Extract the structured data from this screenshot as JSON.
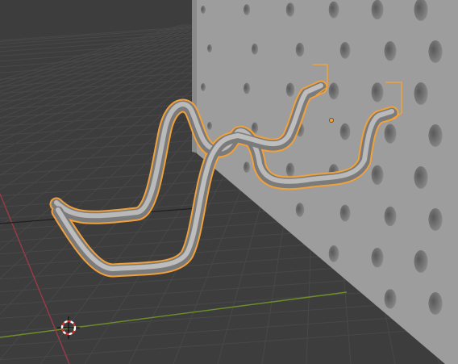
{
  "app": "Blender",
  "viewport": {
    "view": "3d-viewport",
    "shading": "solid",
    "colors": {
      "background": "#3d3d3d",
      "grid_line": "#474747",
      "x_axis": "#9a3b47",
      "y_axis": "#6e8f2a",
      "pegboard": "#9d9d9d",
      "pegboard_side": "#8c8c8c",
      "hole": "#6f6f6f",
      "hook": "#a4a4a4",
      "selection_outline": "#f2a13a"
    },
    "objects": [
      {
        "name": "pegboard",
        "icon": "pegboard-mesh",
        "selected": false
      },
      {
        "name": "hook",
        "icon": "curve-object",
        "selected": true
      }
    ],
    "gizmos": [
      {
        "name": "3d-cursor",
        "icon": "crosshair-cursor"
      },
      {
        "name": "object-origin",
        "icon": "origin-dot"
      }
    ]
  }
}
